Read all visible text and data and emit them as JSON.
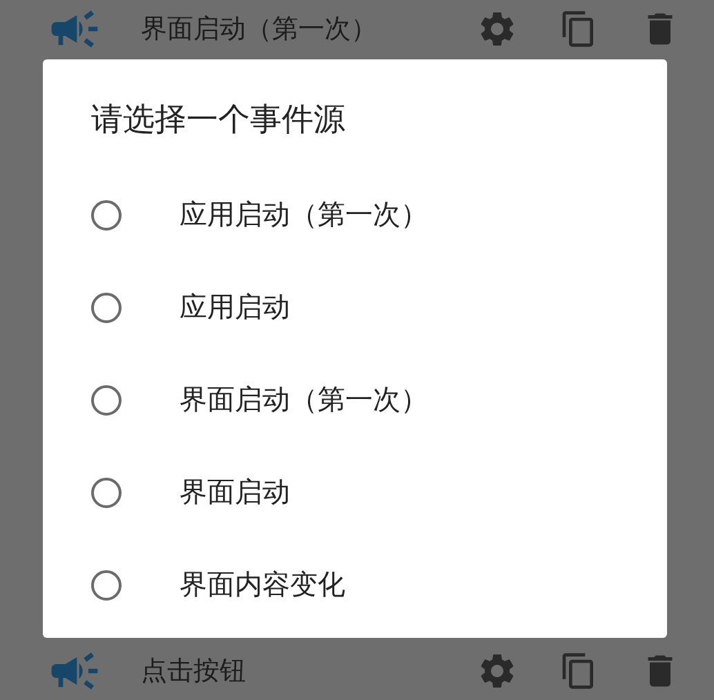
{
  "list": [
    {
      "title": "界面启动（第一次）"
    },
    {
      "title": "点击按钮"
    }
  ],
  "dialog": {
    "title": "请选择一个事件源",
    "options": [
      {
        "label": "应用启动（第一次）",
        "selected": false
      },
      {
        "label": "应用启动",
        "selected": false
      },
      {
        "label": "界面启动（第一次）",
        "selected": false
      },
      {
        "label": "界面启动",
        "selected": false
      },
      {
        "label": "界面内容变化",
        "selected": false
      }
    ]
  }
}
